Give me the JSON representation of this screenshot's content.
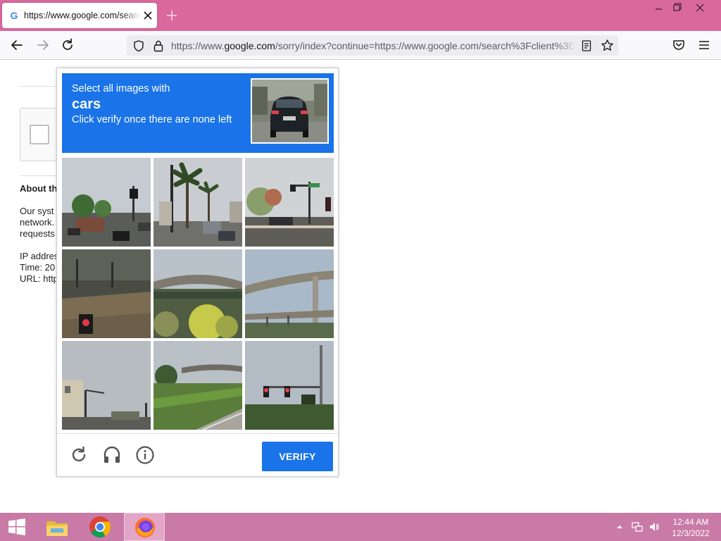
{
  "browser": {
    "tab": {
      "title": "https://www.google.com/search?client"
    },
    "url": {
      "prefix": "https://www.",
      "domain": "google.com",
      "rest": "/sorry/index?continue=https://www.google.com/search%3Fclient%3D"
    }
  },
  "page": {
    "about_heading": "About th",
    "lines": [
      "Our syst",
      "network.",
      "requests",
      "IP addres",
      "Time: 20",
      "URL: http"
    ]
  },
  "captcha": {
    "instruction_line1": "Select all images with",
    "target": "cars",
    "instruction_line2": "Click verify once there are none left",
    "verify_label": "VERIFY",
    "accent_color": "#1a73e8"
  },
  "taskbar": {
    "time": "12:44 AM",
    "date": "12/3/2022"
  }
}
